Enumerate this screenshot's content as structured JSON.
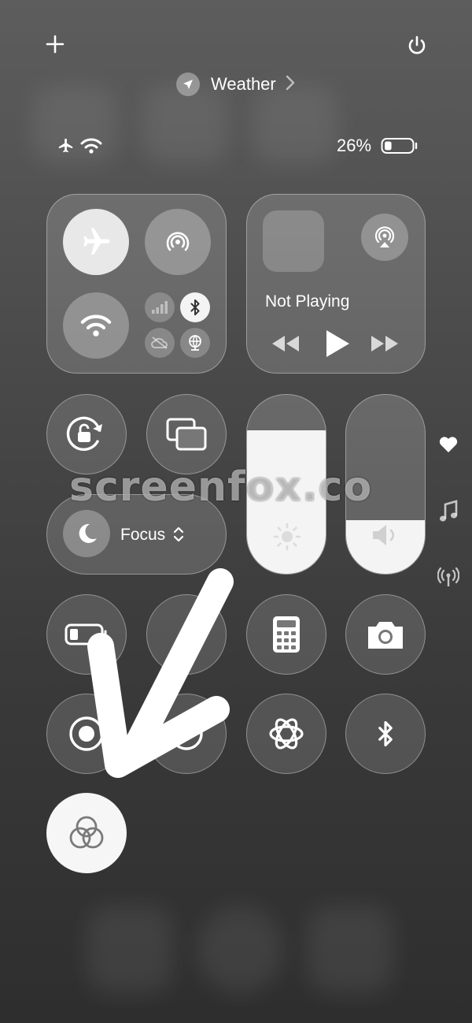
{
  "header": {
    "location_label": "Weather",
    "battery_percent": "26%",
    "battery_level": 0.26
  },
  "media": {
    "status": "Not Playing"
  },
  "focus": {
    "label": "Focus"
  },
  "sliders": {
    "brightness_level": 0.8,
    "volume_level": 0.3
  },
  "watermark": "screenfox.co",
  "side_icons": [
    "heart-icon",
    "music-note-icon",
    "antenna-icon"
  ],
  "colors": {
    "active_tile": "#f4f4f4",
    "glass": "rgba(255,255,255,0.16)"
  }
}
